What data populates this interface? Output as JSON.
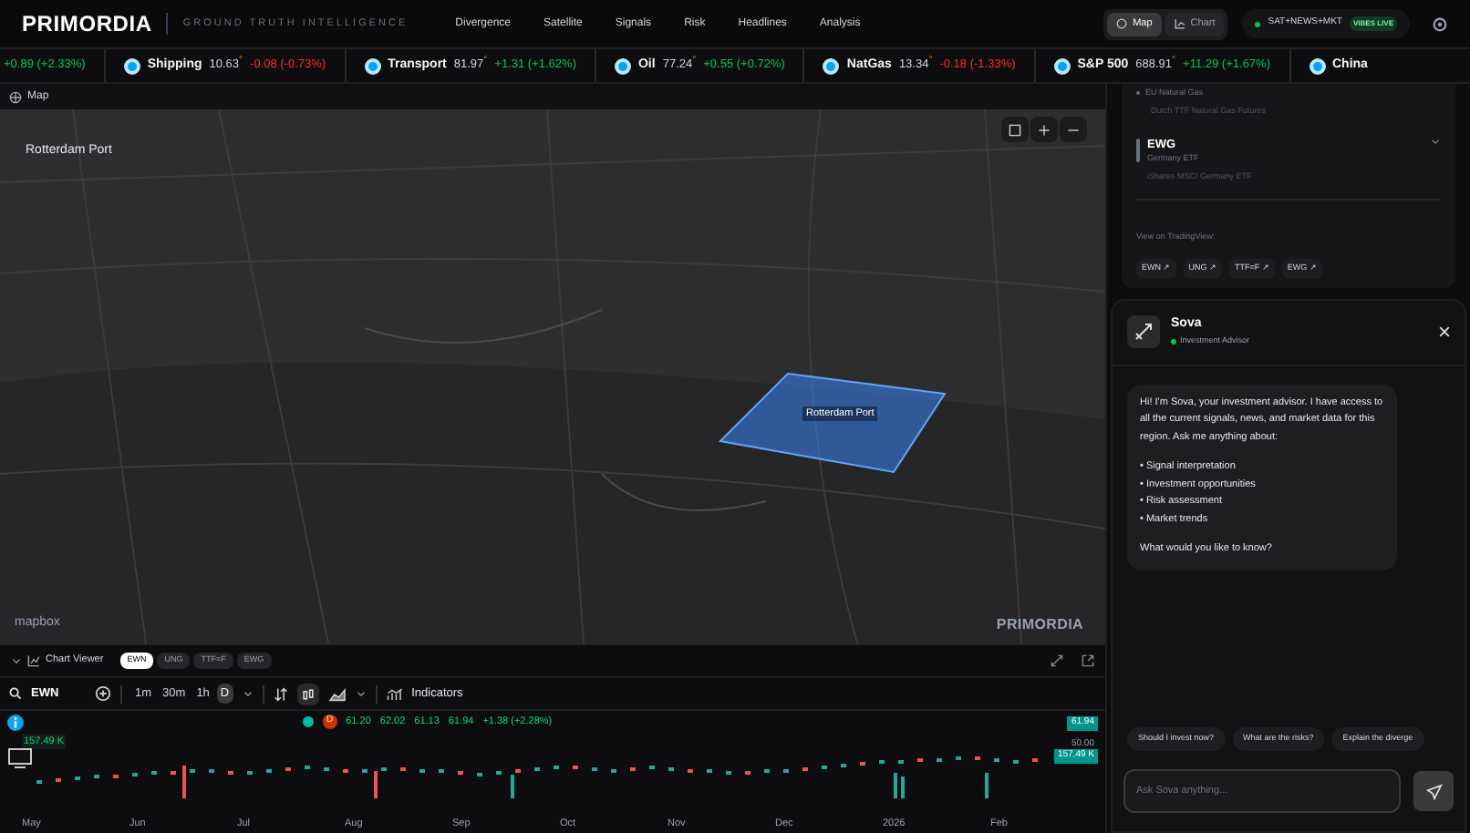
{
  "header": {
    "logo": "PRIMORDIA",
    "tagline": "GROUND TRUTH INTELLIGENCE",
    "nav": [
      {
        "label": "Divergence"
      },
      {
        "label": "Satellite"
      },
      {
        "label": "Signals"
      },
      {
        "label": "Risk"
      },
      {
        "label": "Headlines"
      },
      {
        "label": "Analysis"
      }
    ],
    "view_toggle": [
      {
        "label": "Map",
        "selected": true
      },
      {
        "label": "Chart",
        "selected": false
      }
    ],
    "status": {
      "label": "SAT+NEWS+MKT",
      "badge": "VIBES LIVE"
    }
  },
  "ticker": [
    {
      "change": "+0.89 (+2.33%)",
      "negative": false
    },
    {
      "name": "Shipping",
      "value": "10.63",
      "flag": "°",
      "change": "-0.08 (-0.73%)",
      "negative": true
    },
    {
      "name": "Transport",
      "value": "81.97",
      "flag": "°",
      "change": "+1.31 (+1.62%)",
      "negative": false
    },
    {
      "name": "Oil",
      "value": "77.24",
      "flag": "°",
      "change": "+0.55 (+0.72%)",
      "negative": false
    },
    {
      "name": "NatGas",
      "value": "13.34",
      "flag": "°",
      "change": "-0.18 (-1.33%)",
      "negative": true
    },
    {
      "name": "S&P 500",
      "value": "688.91",
      "flag": "°",
      "change": "+11.29 (+1.67%)",
      "negative": false
    },
    {
      "name": "China"
    }
  ],
  "map": {
    "title": "Map",
    "location_label": "Rotterdam Port",
    "region_label": "Rotterdam Port",
    "watermark": "PRIMORDIA",
    "attribution": "mapbox"
  },
  "instruments": {
    "items": [
      {
        "symbol": "EU Natural Gas",
        "description": "Dutch TTF Natural Gas Futures",
        "expanded": true
      },
      {
        "symbol": "EWG",
        "name": "Germany ETF",
        "description": "iShares MSCI Germany ETF",
        "expanded": false
      }
    ],
    "links_label": "View on TradingView:",
    "links": [
      "EWN ↗",
      "UNG ↗",
      "TTF=F ↗",
      "EWG ↗"
    ]
  },
  "chart_viewer": {
    "title": "Chart Viewer",
    "tabs": [
      {
        "label": "EWN",
        "selected": true
      },
      {
        "label": "UNG",
        "selected": false
      },
      {
        "label": "TTF=F",
        "selected": false
      },
      {
        "label": "EWG",
        "selected": false
      }
    ],
    "symbol": "EWN",
    "intervals": [
      {
        "label": "1m",
        "selected": false
      },
      {
        "label": "30m",
        "selected": false
      },
      {
        "label": "1h",
        "selected": false
      },
      {
        "label": "D",
        "selected": true
      }
    ],
    "indicators": "Indicators",
    "legend": {
      "badge": "D",
      "open": "61.20",
      "high": "62.02",
      "low": "61.13",
      "close": "61.94",
      "change": "+1.38 (+2.28%)"
    },
    "volume_label": "157.49 K",
    "price_tags": [
      {
        "text": "61.94",
        "kind": "price"
      },
      {
        "text": "50.00",
        "kind": "scale"
      },
      {
        "text": "157.49 K",
        "kind": "volume"
      }
    ],
    "months": [
      "May",
      "Jun",
      "Jul",
      "Aug",
      "Sep",
      "Oct",
      "Nov",
      "Dec",
      "2026",
      "Feb"
    ]
  },
  "chat": {
    "name": "Sova",
    "role": "Investment Advisor",
    "message_lines": [
      "Hi! I'm Sova, your investment advisor. I have access to all the current signals, news, and market data for this region. Ask me anything about:"
    ],
    "bullets": [
      "• Signal interpretation",
      "• Investment opportunities",
      "• Risk assessment",
      "• Market trends"
    ],
    "closing": "What would you like to know?",
    "suggestions": [
      "Should I invest now?",
      "What are the risks?",
      "Explain the diverge"
    ],
    "placeholder": "Ask Sova anything..."
  }
}
